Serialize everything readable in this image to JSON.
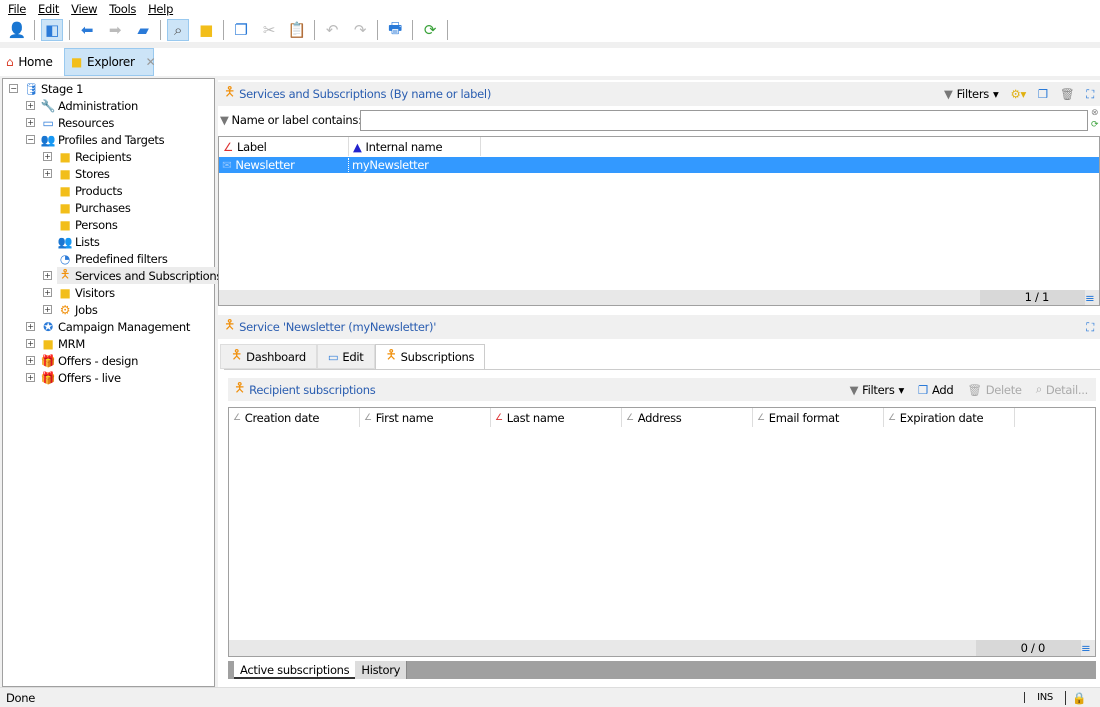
{
  "menu": [
    "File",
    "Edit",
    "View",
    "Tools",
    "Help"
  ],
  "toolbar": {
    "icons": [
      "new-recipient-icon",
      "explorer-view-icon",
      "back-icon",
      "forward-icon",
      "upload-folder-icon",
      "preview-icon",
      "open-folder-icon",
      "copy-icon",
      "cut-icon",
      "paste-icon",
      "undo-icon",
      "redo-icon",
      "print-icon",
      "refresh-icon"
    ]
  },
  "tabs": {
    "home": "Home",
    "explorer": "Explorer"
  },
  "tree": [
    {
      "label": "Stage 1",
      "level": 0,
      "exp": "-",
      "icon": "database-icon",
      "glyph": "🛢",
      "color": "#2a7ad8"
    },
    {
      "label": "Administration",
      "level": 1,
      "exp": "+",
      "icon": "wrench-icon",
      "glyph": "🔧",
      "color": "#f0900c"
    },
    {
      "label": "Resources",
      "level": 1,
      "exp": "+",
      "icon": "resources-icon",
      "glyph": "▭",
      "color": "#2a7ad8"
    },
    {
      "label": "Profiles and Targets",
      "level": 1,
      "exp": "-",
      "icon": "people-icon",
      "glyph": "👥",
      "color": "#2a7ad8"
    },
    {
      "label": "Recipients",
      "level": 2,
      "exp": "+",
      "icon": "folder-icon",
      "glyph": "■",
      "color": "#f2be1a"
    },
    {
      "label": "Stores",
      "level": 2,
      "exp": "+",
      "icon": "folder-icon",
      "glyph": "■",
      "color": "#f2be1a"
    },
    {
      "label": "Products",
      "level": 2,
      "exp": "",
      "icon": "folder-icon",
      "glyph": "■",
      "color": "#f2be1a"
    },
    {
      "label": "Purchases",
      "level": 2,
      "exp": "",
      "icon": "folder-icon",
      "glyph": "■",
      "color": "#f2be1a"
    },
    {
      "label": "Persons",
      "level": 2,
      "exp": "",
      "icon": "folder-icon",
      "glyph": "■",
      "color": "#f2be1a"
    },
    {
      "label": "Lists",
      "level": 2,
      "exp": "",
      "icon": "lists-icon",
      "glyph": "👥",
      "color": "#2a7ad8"
    },
    {
      "label": "Predefined filters",
      "level": 2,
      "exp": "",
      "icon": "filter-icon",
      "glyph": "◔",
      "color": "#2a7ad8"
    },
    {
      "label": "Services and Subscriptions",
      "level": 2,
      "exp": "+",
      "icon": "person-icon",
      "glyph": "🯅",
      "color": "#f0900c",
      "selected": true
    },
    {
      "label": "Visitors",
      "level": 2,
      "exp": "+",
      "icon": "folder-icon",
      "glyph": "■",
      "color": "#f2be1a"
    },
    {
      "label": "Jobs",
      "level": 2,
      "exp": "+",
      "icon": "gears-icon",
      "glyph": "⚙",
      "color": "#f0900c"
    },
    {
      "label": "Campaign Management",
      "level": 1,
      "exp": "+",
      "icon": "campaign-icon",
      "glyph": "✪",
      "color": "#2a7ad8"
    },
    {
      "label": "MRM",
      "level": 1,
      "exp": "+",
      "icon": "folder-gear-icon",
      "glyph": "■",
      "color": "#f2be1a"
    },
    {
      "label": "Offers - design",
      "level": 1,
      "exp": "+",
      "icon": "gift-icon",
      "glyph": "🎁",
      "color": "#f2be1a"
    },
    {
      "label": "Offers - live",
      "level": 1,
      "exp": "+",
      "icon": "gift-icon",
      "glyph": "🎁",
      "color": "#f2be1a"
    }
  ],
  "list": {
    "title": "Services and Subscriptions (By name or label)",
    "filters": "Filters",
    "filter_label": "Name or label contains:",
    "filter_value": "",
    "columns": [
      "Label",
      "Internal name"
    ],
    "rows": [
      [
        "Newsletter",
        "myNewsletter"
      ]
    ],
    "count": "1 / 1"
  },
  "detail": {
    "title": "Service 'Newsletter (myNewsletter)'",
    "tabs": [
      "Dashboard",
      "Edit",
      "Subscriptions"
    ],
    "active_tab": "Subscriptions",
    "sub_title": "Recipient subscriptions",
    "filters": "Filters",
    "add": "Add",
    "delete": "Delete",
    "detail": "Detail...",
    "columns": [
      "Creation date",
      "First name",
      "Last name",
      "Address",
      "Email format",
      "Expiration date"
    ],
    "count": "0 / 0",
    "bottom_tabs": [
      "Active subscriptions",
      "History"
    ]
  },
  "status": {
    "text": "Done",
    "mode": "INS"
  },
  "colors": {
    "accent": "#2a5db0",
    "selection": "#3399ff",
    "orange": "#f0900c"
  }
}
